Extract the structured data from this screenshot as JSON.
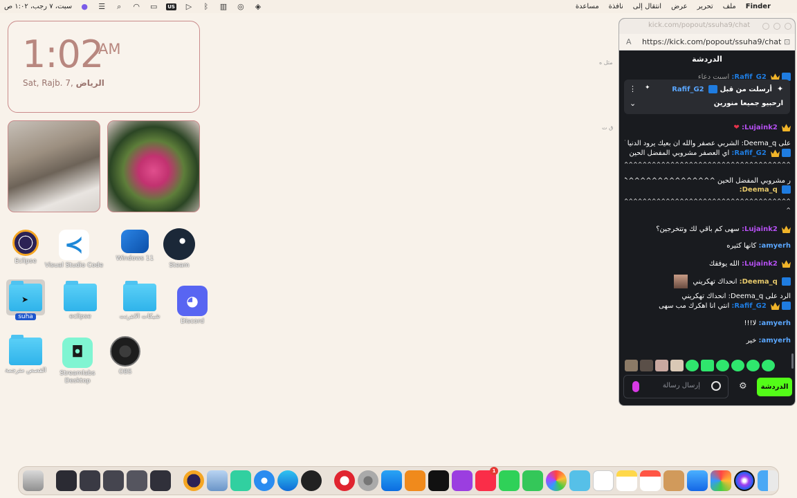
{
  "menubar": {
    "right_items": [
      "Finder",
      "ملف",
      "تحرير",
      "عرض",
      "انتقال إلى",
      "نافذة",
      "مساعدة"
    ],
    "datetime": "سبت، ٧ رجب، ١:٠٢ ص",
    "keyboard_layout": "US"
  },
  "clock_widget": {
    "time": "1:02",
    "ampm": "AM",
    "city": "الرياض",
    "date": "Sat, Rajb. 7,"
  },
  "desktop_icons": {
    "eclipse_app": "Eclipse",
    "vscode": "Visual Studio Code",
    "windows11": "Windows 11",
    "steam": "Steam",
    "suha": "suha",
    "eclipse_folder": "eclipse",
    "scripts_folder": "شبكات الانترنت",
    "discord": "Discord",
    "translation_folder": "القصص مترجمة",
    "streamlabs": "Streamlabs Desktop",
    "obs": "OBS"
  },
  "chat_window": {
    "title": "kick.com/popout/ssuha9/chat",
    "url": "https://kick.com/popout/ssuha9/chat",
    "header": "الدردشة",
    "pinned": {
      "author": "Rafif_G2",
      "sent_by_label": "أرسلت من قبل",
      "text": "ارحبيو جميعا منورين"
    },
    "messages": [
      {
        "type": "reply",
        "text": "على Deema_q: الشربي عصفر والله ان بعيك يرود الدنيا كلها..."
      },
      {
        "user": "Rafif_G2:",
        "text": "اي العصفر مشروبي المفضل الحين",
        "color": "#1f7ce0"
      },
      {
        "user": "",
        "text": "^^^^^^^^^^^^^^^^^^^^^^^^^^^^^^^^^^^^^"
      },
      {
        "type": "reply",
        "text": "ر مشروبي المفضل الحين ^^^^^^^^^^^^^^^^^^^^^^^^^^^^^^^^..."
      },
      {
        "user": "Deema_q:",
        "text": "",
        "color": "#e7c96b"
      },
      {
        "user": "",
        "text": "^^^^^^^^^^^^^^^^^^^^^^^^^^^^^^^^^^^^^^^^^^^^^^^^^^"
      },
      {
        "user": "",
        "text": "^"
      },
      {
        "user": "Lujaink2:",
        "text": "سهى كم باقي لك وتتخرجين؟",
        "color": "#b650f3"
      },
      {
        "user": "amyerh:",
        "text": "كأنها كثيره",
        "color": "#5aa7ff"
      },
      {
        "user": "Lujaink2:",
        "text": "الله يوفقك",
        "color": "#b650f3"
      },
      {
        "user": "Deema_q:",
        "text": "انحداك تهكريني",
        "color": "#e7c96b"
      },
      {
        "type": "reply",
        "text": "الرد على Deema_q: انحداك تهكريني"
      },
      {
        "user": "Rafif_G2:",
        "text": "انتي انا اهكرك مب سهى",
        "color": "#1f7ce0"
      },
      {
        "user": "amyerh:",
        "text": "لا!!!",
        "color": "#5aa7ff"
      },
      {
        "user": "amyerh:",
        "text": "خير",
        "color": "#5aa7ff"
      },
      {
        "user": "Lujaink2:",
        "text": "❤",
        "color": "#b650f3"
      }
    ],
    "top_partial_user": "Rafif_G2:",
    "top_partial_text": "اسبت دعاء",
    "input_placeholder": "إرسال رسالة",
    "chat_button": "الدردشة"
  },
  "background_fragments": {
    "frag1": "مثل ه",
    "frag2": "ق ت"
  },
  "colors": {
    "kick_green": "#53fc18",
    "chat_bg": "#191b1f",
    "clock_text": "#b8877f"
  },
  "icons": [
    "apple-icon",
    "control-center-icon",
    "search-icon",
    "wifi-icon",
    "battery-icon",
    "bluetooth-icon",
    "gear-icon",
    "microphone-icon",
    "smile-icon",
    "pin-icon",
    "kebab-icon",
    "chevron-down-icon"
  ],
  "dock": {
    "music_badge": "1"
  }
}
